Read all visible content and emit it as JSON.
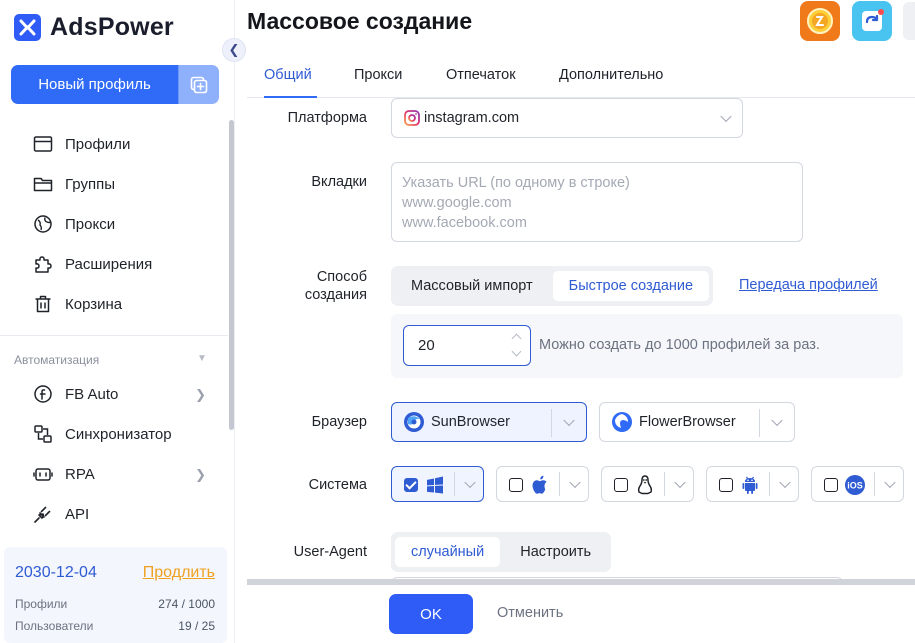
{
  "sidebar": {
    "brand": "AdsPower",
    "new_profile": "Новый профиль",
    "items": [
      {
        "label": "Профили",
        "icon": "profiles-icon"
      },
      {
        "label": "Группы",
        "icon": "folder-icon"
      },
      {
        "label": "Прокси",
        "icon": "proxy-globe-icon"
      },
      {
        "label": "Расширения",
        "icon": "puzzle-icon"
      },
      {
        "label": "Корзина",
        "icon": "trash-icon"
      }
    ],
    "automation_label": "Автоматизация",
    "automation_items": [
      {
        "label": "FB Auto",
        "icon": "facebook-icon"
      },
      {
        "label": "Синхронизатор",
        "icon": "sync-icon"
      },
      {
        "label": "RPA",
        "icon": "robot-icon"
      },
      {
        "label": "API",
        "icon": "plug-icon"
      }
    ],
    "license": {
      "date": "2030-12-04",
      "extend": "Продлить",
      "profiles_label": "Профили",
      "profiles_value": "274 / 1000",
      "users_label": "Пользователи",
      "users_value": "19 / 25"
    }
  },
  "header": {
    "title": "Массовое создание"
  },
  "tabs": [
    {
      "label": "Общий",
      "active": true
    },
    {
      "label": "Прокси",
      "active": false
    },
    {
      "label": "Отпечаток",
      "active": false
    },
    {
      "label": "Дополнительно",
      "active": false
    }
  ],
  "form": {
    "platform_label": "Платформа",
    "platform_value": "instagram.com",
    "tabs_label": "Вкладки",
    "tabs_placeholder_lines": [
      "Указать URL (по одному в строке)",
      "www.google.com",
      "www.facebook.com"
    ],
    "method_label_1": "Способ",
    "method_label_2": "создания",
    "method_options": [
      "Массовый импорт",
      "Быстрое создание"
    ],
    "method_selected": "Быстрое создание",
    "transfer_link": "Передача профилей",
    "quantity": "20",
    "quantity_hint": "Можно создать до 1000 профилей за раз.",
    "browser_label": "Браузер",
    "browsers": [
      "SunBrowser",
      "FlowerBrowser"
    ],
    "browser_selected": "SunBrowser",
    "system_label": "Система",
    "systems": [
      {
        "icon": "windows-icon",
        "checked": true
      },
      {
        "icon": "apple-icon",
        "checked": false
      },
      {
        "icon": "linux-icon",
        "checked": false
      },
      {
        "icon": "android-icon",
        "checked": false
      },
      {
        "icon": "ios-icon",
        "checked": false
      }
    ],
    "ios_text": "iOS",
    "ua_label": "User-Agent",
    "ua_options": [
      "случайный",
      "Настроить"
    ],
    "ua_selected": "случайный"
  },
  "footer": {
    "ok": "OK",
    "cancel": "Отменить"
  },
  "colors": {
    "accent": "#2f6bf6",
    "link": "#2f5bd3",
    "extend": "#f0a020"
  }
}
